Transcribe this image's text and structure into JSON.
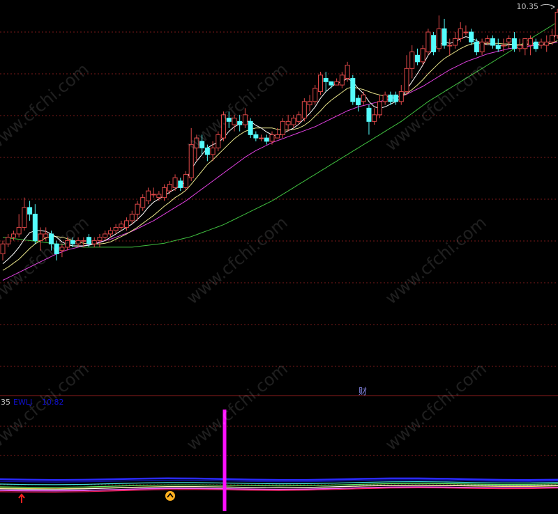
{
  "colors": {
    "up": "#e04848",
    "down": "#54fcfc",
    "ma5": "#ffffff",
    "ma10": "#e8e48a",
    "ma20": "#e040e0",
    "ma60": "#40c040",
    "grid": "#7a1a1a",
    "divider": "#8b1c1c",
    "indicator_bar": "#ff10ff"
  },
  "price_label": "10.35",
  "bottom_panel": {
    "number": "35",
    "name": "EWLJ",
    "value": "10.82"
  },
  "marker_text": "财",
  "watermark": "www.cfchi.com",
  "icons": [
    "arrow-up-icon",
    "caret-up-circle-icon",
    "arrow-right-icon"
  ],
  "chart_data": {
    "type": "candlestick",
    "price_range": [
      5.8,
      10.45
    ],
    "candles": [
      [
        6.7,
        6.85,
        6.6,
        6.9
      ],
      [
        6.85,
        6.95,
        6.8,
        7.0
      ],
      [
        6.95,
        7.0,
        6.9,
        7.05
      ],
      [
        7.0,
        7.1,
        6.95,
        7.3
      ],
      [
        7.1,
        7.4,
        7.05,
        7.55
      ],
      [
        7.4,
        7.3,
        7.2,
        7.5
      ],
      [
        7.3,
        6.9,
        6.85,
        7.45
      ],
      [
        6.9,
        7.0,
        6.75,
        7.1
      ],
      [
        6.95,
        7.0,
        6.9,
        7.1
      ],
      [
        7.0,
        6.85,
        6.75,
        7.05
      ],
      [
        6.85,
        6.7,
        6.6,
        6.9
      ],
      [
        6.75,
        6.8,
        6.65,
        6.85
      ],
      [
        6.8,
        6.9,
        6.75,
        6.95
      ],
      [
        6.9,
        6.85,
        6.8,
        6.95
      ],
      [
        6.85,
        6.9,
        6.8,
        6.95
      ],
      [
        6.9,
        6.9,
        6.8,
        6.95
      ],
      [
        6.95,
        6.85,
        6.8,
        7.0
      ],
      [
        6.85,
        6.9,
        6.8,
        6.95
      ],
      [
        6.9,
        6.95,
        6.8,
        7.0
      ],
      [
        6.95,
        7.0,
        6.9,
        7.05
      ],
      [
        7.0,
        7.05,
        6.95,
        7.1
      ],
      [
        7.05,
        7.1,
        7.0,
        7.15
      ],
      [
        7.1,
        7.15,
        7.05,
        7.2
      ],
      [
        7.1,
        7.2,
        7.05,
        7.25
      ],
      [
        7.2,
        7.3,
        7.15,
        7.35
      ],
      [
        7.3,
        7.45,
        7.2,
        7.5
      ],
      [
        7.4,
        7.55,
        7.35,
        7.6
      ],
      [
        7.5,
        7.65,
        7.45,
        7.7
      ],
      [
        7.6,
        7.6,
        7.55,
        7.7
      ],
      [
        7.55,
        7.6,
        7.5,
        7.65
      ],
      [
        7.55,
        7.7,
        7.5,
        7.75
      ],
      [
        7.65,
        7.75,
        7.6,
        7.8
      ],
      [
        7.7,
        7.85,
        7.65,
        7.9
      ],
      [
        7.8,
        7.7,
        7.65,
        7.85
      ],
      [
        7.7,
        7.9,
        7.65,
        7.95
      ],
      [
        7.85,
        8.35,
        7.8,
        8.6
      ],
      [
        8.3,
        8.45,
        8.1,
        8.5
      ],
      [
        8.4,
        8.3,
        8.2,
        8.5
      ],
      [
        8.3,
        8.2,
        8.1,
        8.35
      ],
      [
        8.2,
        8.3,
        8.1,
        8.4
      ],
      [
        8.3,
        8.5,
        8.25,
        8.55
      ],
      [
        8.45,
        8.8,
        8.4,
        8.85
      ],
      [
        8.75,
        8.7,
        8.6,
        8.85
      ],
      [
        8.65,
        8.75,
        8.55,
        8.8
      ],
      [
        8.7,
        8.65,
        8.55,
        8.8
      ],
      [
        8.65,
        8.8,
        8.6,
        8.9
      ],
      [
        8.7,
        8.5,
        8.45,
        8.75
      ],
      [
        8.5,
        8.45,
        8.4,
        8.55
      ],
      [
        8.45,
        8.45,
        8.4,
        8.5
      ],
      [
        8.45,
        8.4,
        8.35,
        8.5
      ],
      [
        8.4,
        8.5,
        8.35,
        8.55
      ],
      [
        8.45,
        8.5,
        8.45,
        8.6
      ],
      [
        8.5,
        8.7,
        8.45,
        8.75
      ],
      [
        8.65,
        8.7,
        8.55,
        8.8
      ],
      [
        8.65,
        8.75,
        8.6,
        8.8
      ],
      [
        8.7,
        8.8,
        8.65,
        8.85
      ],
      [
        8.75,
        9.0,
        8.7,
        9.05
      ],
      [
        8.95,
        9.0,
        8.85,
        9.1
      ],
      [
        9.0,
        9.2,
        8.95,
        9.25
      ],
      [
        9.15,
        9.4,
        9.1,
        9.45
      ],
      [
        9.35,
        9.3,
        9.15,
        9.45
      ],
      [
        9.3,
        9.25,
        9.2,
        9.3
      ],
      [
        9.25,
        9.3,
        9.25,
        9.35
      ],
      [
        9.25,
        9.4,
        9.2,
        9.45
      ],
      [
        9.35,
        9.55,
        9.3,
        9.6
      ],
      [
        9.35,
        9.0,
        8.95,
        9.4
      ],
      [
        9.05,
        8.95,
        8.85,
        9.1
      ],
      [
        9.0,
        9.1,
        8.95,
        9.15
      ],
      [
        8.9,
        8.7,
        8.5,
        8.95
      ],
      [
        8.7,
        8.8,
        8.65,
        8.9
      ],
      [
        8.8,
        9.0,
        8.75,
        9.1
      ],
      [
        9.0,
        9.1,
        8.95,
        9.15
      ],
      [
        9.1,
        9.0,
        8.95,
        9.15
      ],
      [
        9.1,
        9.0,
        8.95,
        9.15
      ],
      [
        9.0,
        9.15,
        8.95,
        9.25
      ],
      [
        9.15,
        9.5,
        9.1,
        9.7
      ],
      [
        9.5,
        9.75,
        9.35,
        9.85
      ],
      [
        9.7,
        9.6,
        9.55,
        9.8
      ],
      [
        9.6,
        9.8,
        9.55,
        9.85
      ],
      [
        9.75,
        10.05,
        9.7,
        10.1
      ],
      [
        10.0,
        9.75,
        9.7,
        10.05
      ],
      [
        9.8,
        10.1,
        9.75,
        10.3
      ],
      [
        10.1,
        9.85,
        9.8,
        10.25
      ],
      [
        9.85,
        9.85,
        9.7,
        9.95
      ],
      [
        9.85,
        9.95,
        9.8,
        10.05
      ],
      [
        9.95,
        10.1,
        9.9,
        10.2
      ],
      [
        10.05,
        10.05,
        10.0,
        10.15
      ],
      [
        10.05,
        9.9,
        9.85,
        10.1
      ],
      [
        9.9,
        9.75,
        9.7,
        9.95
      ],
      [
        9.75,
        9.9,
        9.7,
        9.95
      ],
      [
        9.9,
        9.95,
        9.85,
        10.0
      ],
      [
        9.95,
        9.85,
        9.8,
        10.0
      ],
      [
        9.85,
        9.8,
        9.75,
        9.95
      ],
      [
        9.85,
        9.85,
        9.75,
        9.95
      ],
      [
        9.9,
        9.95,
        9.8,
        10.0
      ],
      [
        9.95,
        9.8,
        9.75,
        10.05
      ],
      [
        9.8,
        9.85,
        9.75,
        9.95
      ],
      [
        9.8,
        9.95,
        9.7,
        9.9
      ],
      [
        9.85,
        9.95,
        9.7,
        10.0
      ],
      [
        9.9,
        9.8,
        9.75,
        9.95
      ],
      [
        9.85,
        9.9,
        9.8,
        9.95
      ],
      [
        9.85,
        9.9,
        9.75,
        10.0
      ],
      [
        9.9,
        10.0,
        9.85,
        10.1
      ],
      [
        10.0,
        10.35,
        9.95,
        10.4
      ]
    ],
    "ma5": [
      6.55,
      6.62,
      6.7,
      6.8,
      6.92,
      7.02,
      7.05,
      7.05,
      7.04,
      7.0,
      6.95,
      6.88,
      6.84,
      6.82,
      6.82,
      6.82,
      6.83,
      6.85,
      6.87,
      6.9,
      6.95,
      7.0,
      7.05,
      7.1,
      7.15,
      7.22,
      7.3,
      7.4,
      7.48,
      7.53,
      7.58,
      7.63,
      7.68,
      7.73,
      7.8,
      7.98,
      8.1,
      8.2,
      8.3,
      8.35,
      8.38,
      8.45,
      8.55,
      8.62,
      8.66,
      8.7,
      8.7,
      8.64,
      8.6,
      8.54,
      8.5,
      8.48,
      8.52,
      8.56,
      8.6,
      8.66,
      8.74,
      8.82,
      8.92,
      9.05,
      9.15,
      9.22,
      9.28,
      9.3,
      9.35,
      9.3,
      9.2,
      9.12,
      9.0,
      8.92,
      8.9,
      8.92,
      8.96,
      9.0,
      9.05,
      9.18,
      9.3,
      9.42,
      9.55,
      9.7,
      9.8,
      9.85,
      9.9,
      9.88,
      9.9,
      9.95,
      9.98,
      9.96,
      9.92,
      9.88,
      9.86,
      9.86,
      9.85,
      9.84,
      9.86,
      9.86,
      9.84,
      9.86,
      9.88,
      9.87,
      9.86,
      9.88,
      9.92,
      10.05
    ],
    "ma10": [
      6.45,
      6.5,
      6.56,
      6.62,
      6.7,
      6.78,
      6.85,
      6.9,
      6.94,
      6.96,
      6.96,
      6.95,
      6.93,
      6.9,
      6.88,
      6.86,
      6.85,
      6.85,
      6.85,
      6.86,
      6.88,
      6.92,
      6.96,
      7.0,
      7.05,
      7.1,
      7.16,
      7.22,
      7.28,
      7.35,
      7.42,
      7.48,
      7.55,
      7.6,
      7.66,
      7.75,
      7.85,
      7.95,
      8.05,
      8.12,
      8.2,
      8.28,
      8.36,
      8.44,
      8.5,
      8.55,
      8.58,
      8.6,
      8.6,
      8.6,
      8.6,
      8.58,
      8.57,
      8.57,
      8.58,
      8.6,
      8.64,
      8.7,
      8.78,
      8.86,
      8.95,
      9.02,
      9.08,
      9.14,
      9.2,
      9.22,
      9.2,
      9.18,
      9.15,
      9.12,
      9.1,
      9.08,
      9.07,
      9.07,
      9.08,
      9.12,
      9.18,
      9.25,
      9.33,
      9.42,
      9.5,
      9.58,
      9.65,
      9.7,
      9.75,
      9.8,
      9.84,
      9.87,
      9.88,
      9.88,
      9.88,
      9.88,
      9.88,
      9.87,
      9.87,
      9.86,
      9.86,
      9.86,
      9.86,
      9.86,
      9.86,
      9.87,
      9.88,
      9.92
    ],
    "ma20": [
      6.3,
      6.34,
      6.38,
      6.42,
      6.46,
      6.5,
      6.54,
      6.58,
      6.62,
      6.66,
      6.7,
      6.73,
      6.76,
      6.78,
      6.8,
      6.82,
      6.84,
      6.86,
      6.88,
      6.9,
      6.92,
      6.95,
      6.98,
      7.01,
      7.04,
      7.08,
      7.12,
      7.16,
      7.2,
      7.25,
      7.3,
      7.35,
      7.4,
      7.45,
      7.5,
      7.56,
      7.62,
      7.68,
      7.74,
      7.8,
      7.86,
      7.92,
      7.98,
      8.04,
      8.1,
      8.16,
      8.21,
      8.26,
      8.3,
      8.34,
      8.38,
      8.41,
      8.44,
      8.47,
      8.5,
      8.53,
      8.56,
      8.59,
      8.62,
      8.66,
      8.7,
      8.74,
      8.78,
      8.82,
      8.86,
      8.89,
      8.92,
      8.94,
      8.96,
      8.98,
      9.0,
      9.02,
      9.04,
      9.06,
      9.08,
      9.11,
      9.15,
      9.19,
      9.23,
      9.28,
      9.33,
      9.38,
      9.43,
      9.48,
      9.52,
      9.56,
      9.6,
      9.63,
      9.66,
      9.69,
      9.72,
      9.74,
      9.76,
      9.78,
      9.8,
      9.81,
      9.82,
      9.83,
      9.84,
      9.85,
      9.86,
      9.87,
      9.88,
      9.9
    ],
    "ma60": [
      6.95,
      6.94,
      6.93,
      6.92,
      6.91,
      6.9,
      6.89,
      6.88,
      6.87,
      6.86,
      6.85,
      6.84,
      6.83,
      6.82,
      6.81,
      6.8,
      6.8,
      6.8,
      6.8,
      6.8,
      6.8,
      6.8,
      6.8,
      6.8,
      6.8,
      6.81,
      6.82,
      6.83,
      6.84,
      6.85,
      6.86,
      6.88,
      6.9,
      6.92,
      6.94,
      6.96,
      6.99,
      7.02,
      7.05,
      7.08,
      7.11,
      7.14,
      7.18,
      7.22,
      7.26,
      7.3,
      7.34,
      7.38,
      7.42,
      7.46,
      7.5,
      7.55,
      7.6,
      7.65,
      7.7,
      7.75,
      7.8,
      7.85,
      7.9,
      7.95,
      8.0,
      8.05,
      8.1,
      8.15,
      8.2,
      8.25,
      8.3,
      8.35,
      8.4,
      8.45,
      8.5,
      8.55,
      8.6,
      8.65,
      8.7,
      8.76,
      8.82,
      8.88,
      8.94,
      9.0,
      9.05,
      9.1,
      9.15,
      9.2,
      9.25,
      9.3,
      9.35,
      9.4,
      9.45,
      9.5,
      9.55,
      9.6,
      9.65,
      9.7,
      9.75,
      9.8,
      9.85,
      9.9,
      9.95,
      10.0,
      10.05,
      10.1,
      10.15,
      10.2
    ],
    "indicator_bar_index": 45
  }
}
